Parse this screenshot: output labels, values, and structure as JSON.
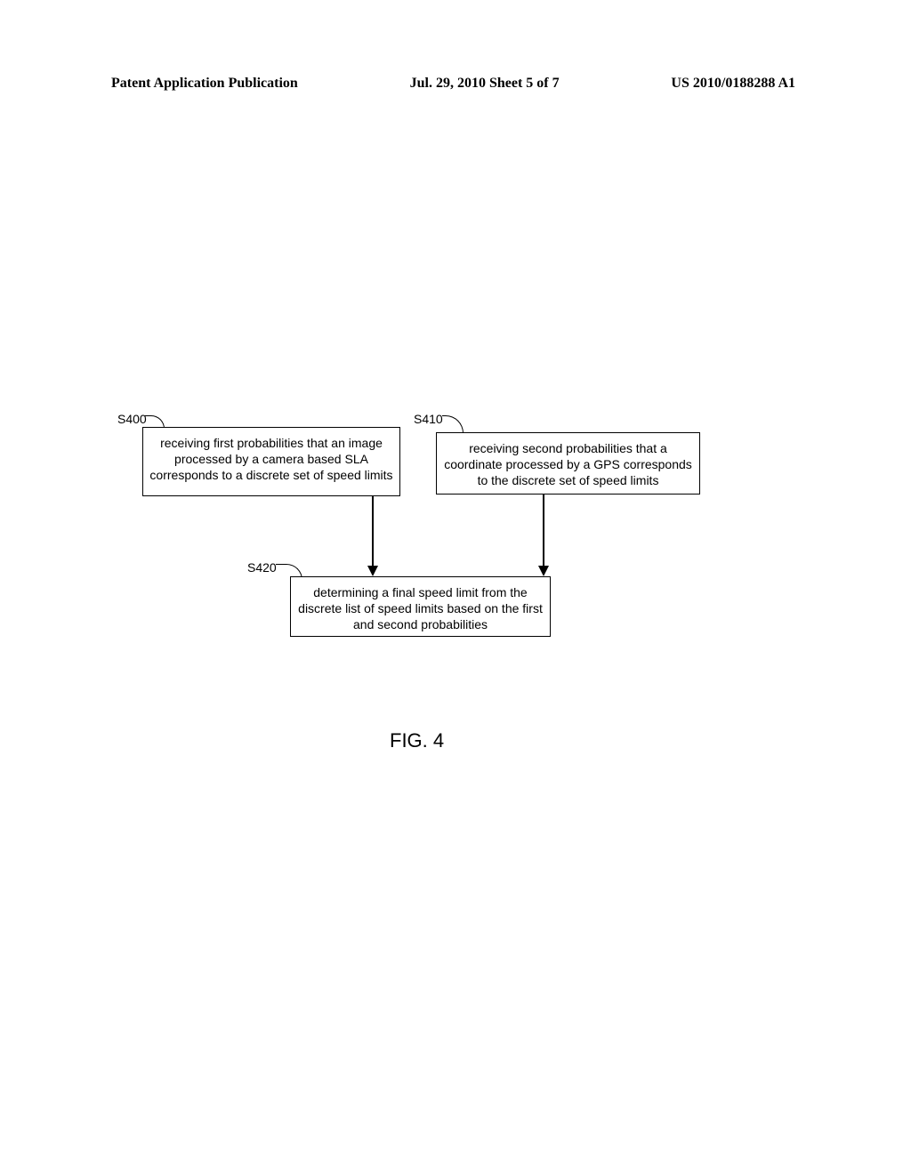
{
  "header": {
    "left": "Patent Application Publication",
    "center": "Jul. 29, 2010  Sheet 5 of 7",
    "right": "US 2010/0188288 A1"
  },
  "diagram": {
    "labels": {
      "s400": "S400",
      "s410": "S410",
      "s420": "S420"
    },
    "boxes": {
      "s400": "receiving first probabilities that an image processed by a camera based SLA corresponds to a discrete set of speed limits",
      "s410": "receiving second probabilities that a coordinate processed by a GPS corresponds to the discrete set of speed limits",
      "s420": "determining a final speed limit from the discrete list of speed limits based on the first and second probabilities"
    }
  },
  "figure_label": "FIG. 4"
}
